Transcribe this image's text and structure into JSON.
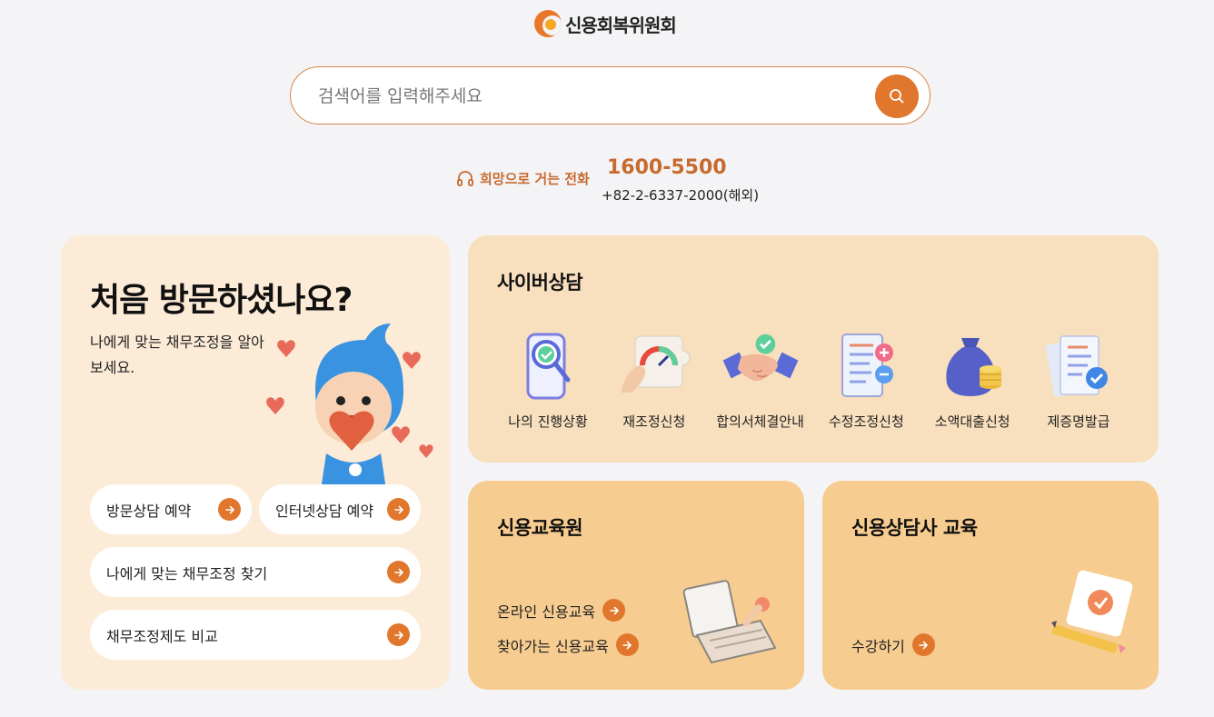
{
  "header": {
    "logo_text": "신용회복위원회"
  },
  "search": {
    "placeholder": "검색어를 입력해주세요"
  },
  "contact": {
    "label": "희망으로 거는 전화",
    "phone": "1600-5500",
    "overseas": "+82-2-6337-2000(해외)"
  },
  "visit": {
    "title": "처음 방문하셨나요?",
    "subtitle": "나에게 맞는 채무조정을 알아보세요.",
    "buttons": [
      "방문상담 예약",
      "인터넷상담 예약",
      "나에게 맞는 채무조정 찾기",
      "채무조정제도 비교"
    ]
  },
  "cyber": {
    "title": "사이버상담",
    "items": [
      {
        "label": "나의 진행상황",
        "icon": "magnifier-check-icon"
      },
      {
        "label": "재조정신청",
        "icon": "gauge-icon"
      },
      {
        "label": "합의서체결안내",
        "icon": "handshake-icon"
      },
      {
        "label": "수정조정신청",
        "icon": "document-plus-minus-icon"
      },
      {
        "label": "소액대출신청",
        "icon": "money-bag-icon"
      },
      {
        "label": "제증명발급",
        "icon": "certificate-check-icon"
      }
    ]
  },
  "education": {
    "title": "신용교육원",
    "links": [
      "온라인 신용교육",
      "찾아가는 신용교육"
    ]
  },
  "counselor": {
    "title": "신용상담사 교육",
    "link": "수강하기"
  },
  "colors": {
    "accent": "#e0772c",
    "card_light": "#fcebd7",
    "card_mid": "#f8dfbd",
    "card_dark": "#f7cc90"
  }
}
